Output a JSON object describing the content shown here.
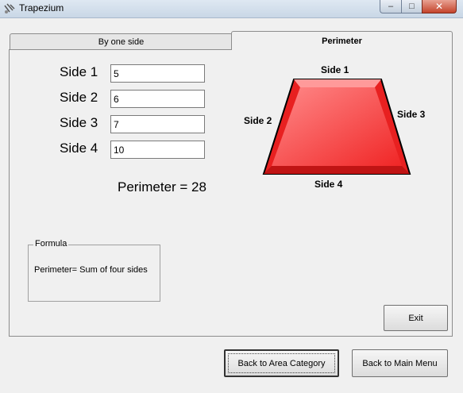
{
  "window": {
    "title": "Trapezium",
    "icon": "tools-icon",
    "controls": {
      "minimize": "–",
      "maximize": "□",
      "close": "✕"
    }
  },
  "tabs": [
    {
      "label": "By one side",
      "selected": false
    },
    {
      "label": "Perimeter",
      "selected": true
    }
  ],
  "sides": [
    {
      "label": "Side 1",
      "value": "5"
    },
    {
      "label": "Side 2",
      "value": "6"
    },
    {
      "label": "Side 3",
      "value": "7"
    },
    {
      "label": "Side 4",
      "value": "10"
    }
  ],
  "result": {
    "perimeter_text": "Perimeter = 28"
  },
  "figure": {
    "labels": {
      "top": "Side 1",
      "left": "Side 2",
      "right": "Side 3",
      "bottom": "Side 4"
    },
    "colors": {
      "fill": "#ff3b3b",
      "inner": "#ff6f6f",
      "stroke": "#000000"
    }
  },
  "formula": {
    "legend": "Formula",
    "text": "Perimeter= Sum of four sides"
  },
  "buttons": {
    "exit": "Exit",
    "back_area": "Back to Area Category",
    "back_main": "Back to Main Menu"
  }
}
